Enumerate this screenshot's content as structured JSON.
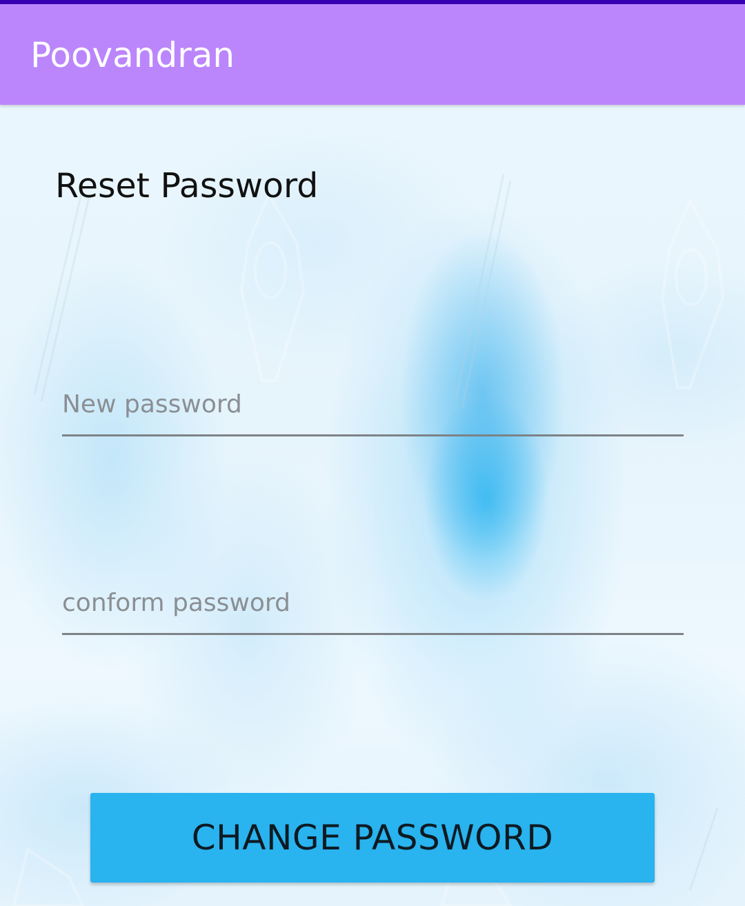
{
  "app_bar": {
    "title": "Poovandran",
    "color": "#bb86fc",
    "status_color": "#3700b3"
  },
  "form": {
    "heading": "Reset Password",
    "new_password": {
      "placeholder": "New password",
      "value": ""
    },
    "confirm_password": {
      "placeholder": "conform password",
      "value": ""
    },
    "submit_label": "CHANGE PASSWORD",
    "submit_color": "#29b3ef"
  }
}
